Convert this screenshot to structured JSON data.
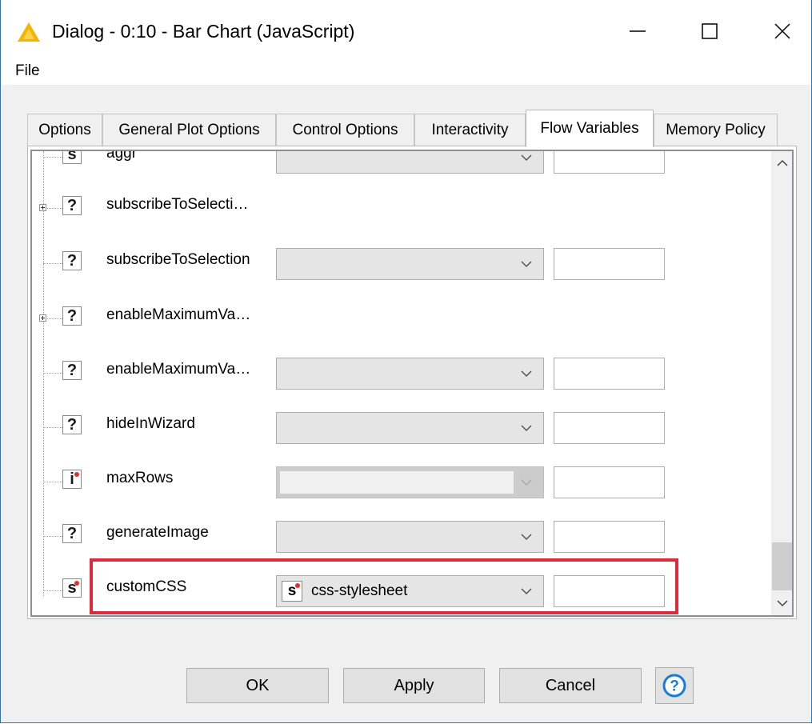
{
  "window": {
    "title": "Dialog - 0:10 - Bar Chart (JavaScript)",
    "minimize_symbol": "—",
    "maximize_symbol": "☐",
    "close_symbol": "✕"
  },
  "menu": {
    "file": "File"
  },
  "tabs": [
    {
      "label": "Options",
      "active": false
    },
    {
      "label": "General Plot Options",
      "active": false
    },
    {
      "label": "Control Options",
      "active": false
    },
    {
      "label": "Interactivity",
      "active": false
    },
    {
      "label": "Flow Variables",
      "active": true
    },
    {
      "label": "Memory Policy",
      "active": false
    }
  ],
  "rows": [
    {
      "icon_letter": "s",
      "label": "aggr",
      "kind": "setting"
    },
    {
      "icon_letter": "?",
      "label": "subscribeToSelecti…",
      "kind": "group"
    },
    {
      "icon_letter": "?",
      "label": "subscribeToSelection",
      "kind": "setting"
    },
    {
      "icon_letter": "?",
      "label": "enableMaximumVa…",
      "kind": "group"
    },
    {
      "icon_letter": "?",
      "label": "enableMaximumVa…",
      "kind": "setting"
    },
    {
      "icon_letter": "?",
      "label": "hideInWizard",
      "kind": "setting"
    },
    {
      "icon_letter": "i",
      "label": "maxRows",
      "kind": "setting-disabled"
    },
    {
      "icon_letter": "?",
      "label": "generateImage",
      "kind": "setting"
    },
    {
      "icon_letter": "s",
      "label": "customCSS",
      "kind": "setting",
      "selected_value": "css-stylesheet",
      "value_icon_letter": "s"
    }
  ],
  "buttons": {
    "ok": "OK",
    "apply": "Apply",
    "cancel": "Cancel",
    "help": "?"
  },
  "colors": {
    "highlight": "#e02a3a",
    "window_border": "#1979ca",
    "help_icon": "#1a7bd6",
    "app_icon": "#f5b400"
  }
}
